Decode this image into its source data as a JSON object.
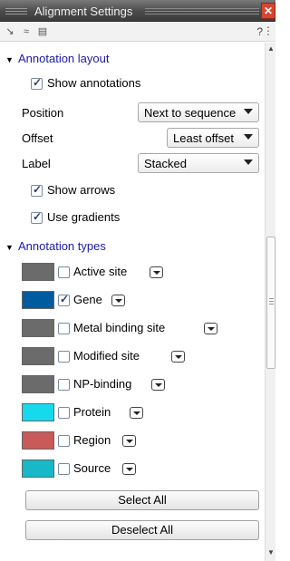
{
  "window": {
    "title": "Alignment Settings",
    "close_glyph": "✕"
  },
  "toolbar": {
    "icons": [
      "pointer-icon",
      "wave-icon",
      "list-icon"
    ],
    "help": "?"
  },
  "sections": {
    "annotation_layout": {
      "title": "Annotation layout",
      "show_annotations": {
        "label": "Show annotations",
        "checked": true
      },
      "position": {
        "label": "Position",
        "value": "Next to sequence"
      },
      "offset": {
        "label": "Offset",
        "value": "Least offset"
      },
      "label": {
        "label": "Label",
        "value": "Stacked"
      },
      "show_arrows": {
        "label": "Show arrows",
        "checked": true
      },
      "use_gradients": {
        "label": "Use gradients",
        "checked": true
      }
    },
    "annotation_types": {
      "title": "Annotation types",
      "items": [
        {
          "label": "Active site",
          "checked": false,
          "color": "#6b6b6b"
        },
        {
          "label": "Gene",
          "checked": true,
          "color": "#005c9e"
        },
        {
          "label": "Metal binding site",
          "checked": false,
          "color": "#6b6b6b"
        },
        {
          "label": "Modified site",
          "checked": false,
          "color": "#6b6b6b"
        },
        {
          "label": "NP-binding",
          "checked": false,
          "color": "#6b6b6b"
        },
        {
          "label": "Protein",
          "checked": false,
          "color": "#17d9ee"
        },
        {
          "label": "Region",
          "checked": false,
          "color": "#c85a5a"
        },
        {
          "label": "Source",
          "checked": false,
          "color": "#17b8c8"
        }
      ]
    }
  },
  "buttons": {
    "select_all": "Select All",
    "deselect_all": "Deselect All"
  }
}
